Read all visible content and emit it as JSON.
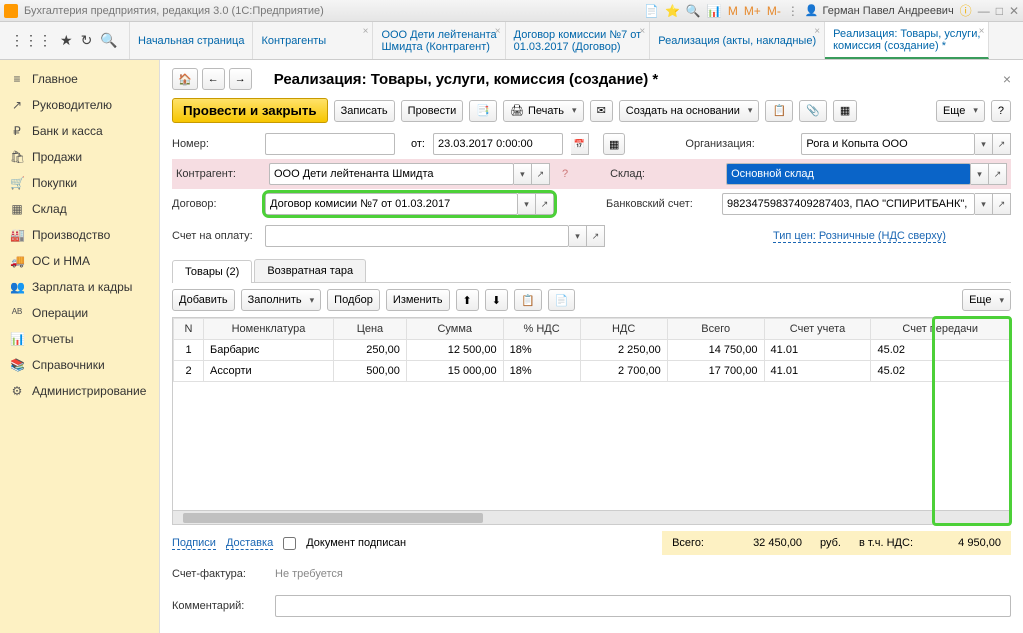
{
  "app_title": "Бухгалтерия предприятия, редакция 3.0  (1С:Предприятие)",
  "user_name": "Герман Павел Андреевич",
  "tabs": [
    {
      "l1": "Начальная страница",
      "l2": ""
    },
    {
      "l1": "Контрагенты",
      "l2": ""
    },
    {
      "l1": "ООО Дети лейтенанта",
      "l2": "Шмидта (Контрагент)"
    },
    {
      "l1": "Договор комиссии №7 от",
      "l2": "01.03.2017 (Договор)"
    },
    {
      "l1": "Реализация (акты, накладные)",
      "l2": ""
    },
    {
      "l1": "Реализация: Товары, услуги,",
      "l2": "комиссия (создание) *"
    }
  ],
  "sidebar": [
    {
      "ico": "≡",
      "label": "Главное"
    },
    {
      "ico": "↗",
      "label": "Руководителю"
    },
    {
      "ico": "₽",
      "label": "Банк и касса"
    },
    {
      "ico": "🛍",
      "label": "Продажи"
    },
    {
      "ico": "🛒",
      "label": "Покупки"
    },
    {
      "ico": "▦",
      "label": "Склад"
    },
    {
      "ico": "🏭",
      "label": "Производство"
    },
    {
      "ico": "🚚",
      "label": "ОС и НМА"
    },
    {
      "ico": "👥",
      "label": "Зарплата и кадры"
    },
    {
      "ico": "ᴬᴮ",
      "label": "Операции"
    },
    {
      "ico": "📊",
      "label": "Отчеты"
    },
    {
      "ico": "📚",
      "label": "Справочники"
    },
    {
      "ico": "⚙",
      "label": "Администрирование"
    }
  ],
  "doc_title": "Реализация: Товары, услуги, комиссия (создание) *",
  "toolbar": {
    "post_close": "Провести и закрыть",
    "write": "Записать",
    "post": "Провести",
    "print": "Печать",
    "create_based": "Создать на основании",
    "more": "Еще"
  },
  "form": {
    "number_lbl": "Номер:",
    "from_lbl": "от:",
    "date": "23.03.2017  0:00:00",
    "org_lbl": "Организация:",
    "org": "Рога и Копыта ООО",
    "contr_lbl": "Контрагент:",
    "contr": "ООО Дети лейтенанта Шмидта",
    "wh_lbl": "Склад:",
    "wh": "Основной склад",
    "dog_lbl": "Договор:",
    "dog": "Договор комисии №7 от 01.03.2017",
    "bank_lbl": "Банковский счет:",
    "bank": "98234759837409287403, ПАО \"СПИРИТБАНК\",",
    "pay_lbl": "Счет на оплату:",
    "price_type": "Тип цен: Розничные (НДС сверху)"
  },
  "tabstrip": {
    "t1": "Товары (2)",
    "t2": "Возвратная тара"
  },
  "grid_toolbar": {
    "add": "Добавить",
    "fill": "Заполнить",
    "select": "Подбор",
    "change": "Изменить",
    "more": "Еще"
  },
  "grid": {
    "cols": [
      "N",
      "Номенклатура",
      "Цена",
      "Сумма",
      "% НДС",
      "НДС",
      "Всего",
      "Счет учета",
      "Счет передачи"
    ],
    "rows": [
      {
        "n": "1",
        "nom": "Барбарис",
        "price": "250,00",
        "sum": "12 500,00",
        "vatp": "18%",
        "vat": "2 250,00",
        "total": "14 750,00",
        "acc": "41.01",
        "acc_tr": "45.02"
      },
      {
        "n": "2",
        "nom": "Ассорти",
        "price": "500,00",
        "sum": "15 000,00",
        "vatp": "18%",
        "vat": "2 700,00",
        "total": "17 700,00",
        "acc": "41.01",
        "acc_tr": "45.02"
      }
    ]
  },
  "footer": {
    "sign": "Подписи",
    "deliv": "Доставка",
    "signed": "Документ подписан",
    "total_lbl": "Всего:",
    "total": "32 450,00",
    "curr": "руб.",
    "vat_lbl": "в т.ч. НДС:",
    "vat": "4 950,00",
    "sf_lbl": "Счет-фактура:",
    "sf_val": "Не требуется",
    "comment_lbl": "Комментарий:"
  }
}
